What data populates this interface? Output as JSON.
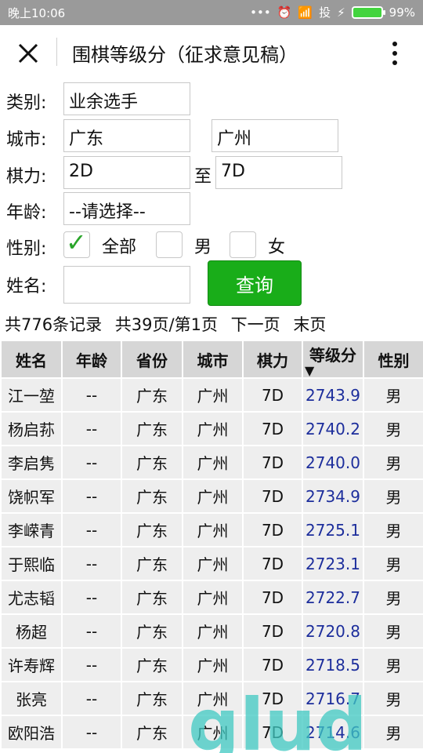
{
  "status_bar": {
    "time": "晚上10:06",
    "signal_text": "•••",
    "carrier": "投",
    "battery": "99%"
  },
  "app_bar": {
    "title": "围棋等级分（征求意见稿）"
  },
  "form": {
    "category": {
      "label": "类别:",
      "value": "业余选手"
    },
    "city": {
      "label": "城市:",
      "province": "广东",
      "city": "广州"
    },
    "strength": {
      "label": "棋力:",
      "from": "2D",
      "separator": "至",
      "to": "7D"
    },
    "age": {
      "label": "年龄:",
      "value": "--请选择--"
    },
    "gender": {
      "label": "性别:",
      "options": [
        "全部",
        "男",
        "女"
      ],
      "selected": "全部"
    },
    "name": {
      "label": "姓名:",
      "value": ""
    },
    "query_button": "查询"
  },
  "pager": {
    "total": "共776条记录",
    "pages": "共39页/第1页",
    "next": "下一页",
    "last": "末页"
  },
  "table": {
    "columns": [
      "姓名",
      "年龄",
      "省份",
      "城市",
      "棋力",
      "等级分",
      "性别"
    ],
    "rows": [
      [
        "江一堃",
        "--",
        "广东",
        "广州",
        "7D",
        "2743.9",
        "男"
      ],
      [
        "杨启荪",
        "--",
        "广东",
        "广州",
        "7D",
        "2740.2",
        "男"
      ],
      [
        "李启隽",
        "--",
        "广东",
        "广州",
        "7D",
        "2740.0",
        "男"
      ],
      [
        "饶帜军",
        "--",
        "广东",
        "广州",
        "7D",
        "2734.9",
        "男"
      ],
      [
        "李嵘青",
        "--",
        "广东",
        "广州",
        "7D",
        "2725.1",
        "男"
      ],
      [
        "于熙临",
        "--",
        "广东",
        "广州",
        "7D",
        "2723.1",
        "男"
      ],
      [
        "尤志韬",
        "--",
        "广东",
        "广州",
        "7D",
        "2722.7",
        "男"
      ],
      [
        "杨超",
        "--",
        "广东",
        "广州",
        "7D",
        "2720.8",
        "男"
      ],
      [
        "许寿辉",
        "--",
        "广东",
        "广州",
        "7D",
        "2718.5",
        "男"
      ],
      [
        "张亮",
        "--",
        "广东",
        "广州",
        "7D",
        "2716.7",
        "男"
      ],
      [
        "欧阳浩",
        "--",
        "广东",
        "广州",
        "7D",
        "2714.6",
        "男"
      ]
    ]
  },
  "watermark": {
    "text": "glud"
  },
  "colors": {
    "accent": "#19ad19",
    "rating": "#1d2e9c",
    "header_bg": "#d6d6d6",
    "row_bg": "#eeeeee",
    "statusbar": "#9a9a9a"
  }
}
